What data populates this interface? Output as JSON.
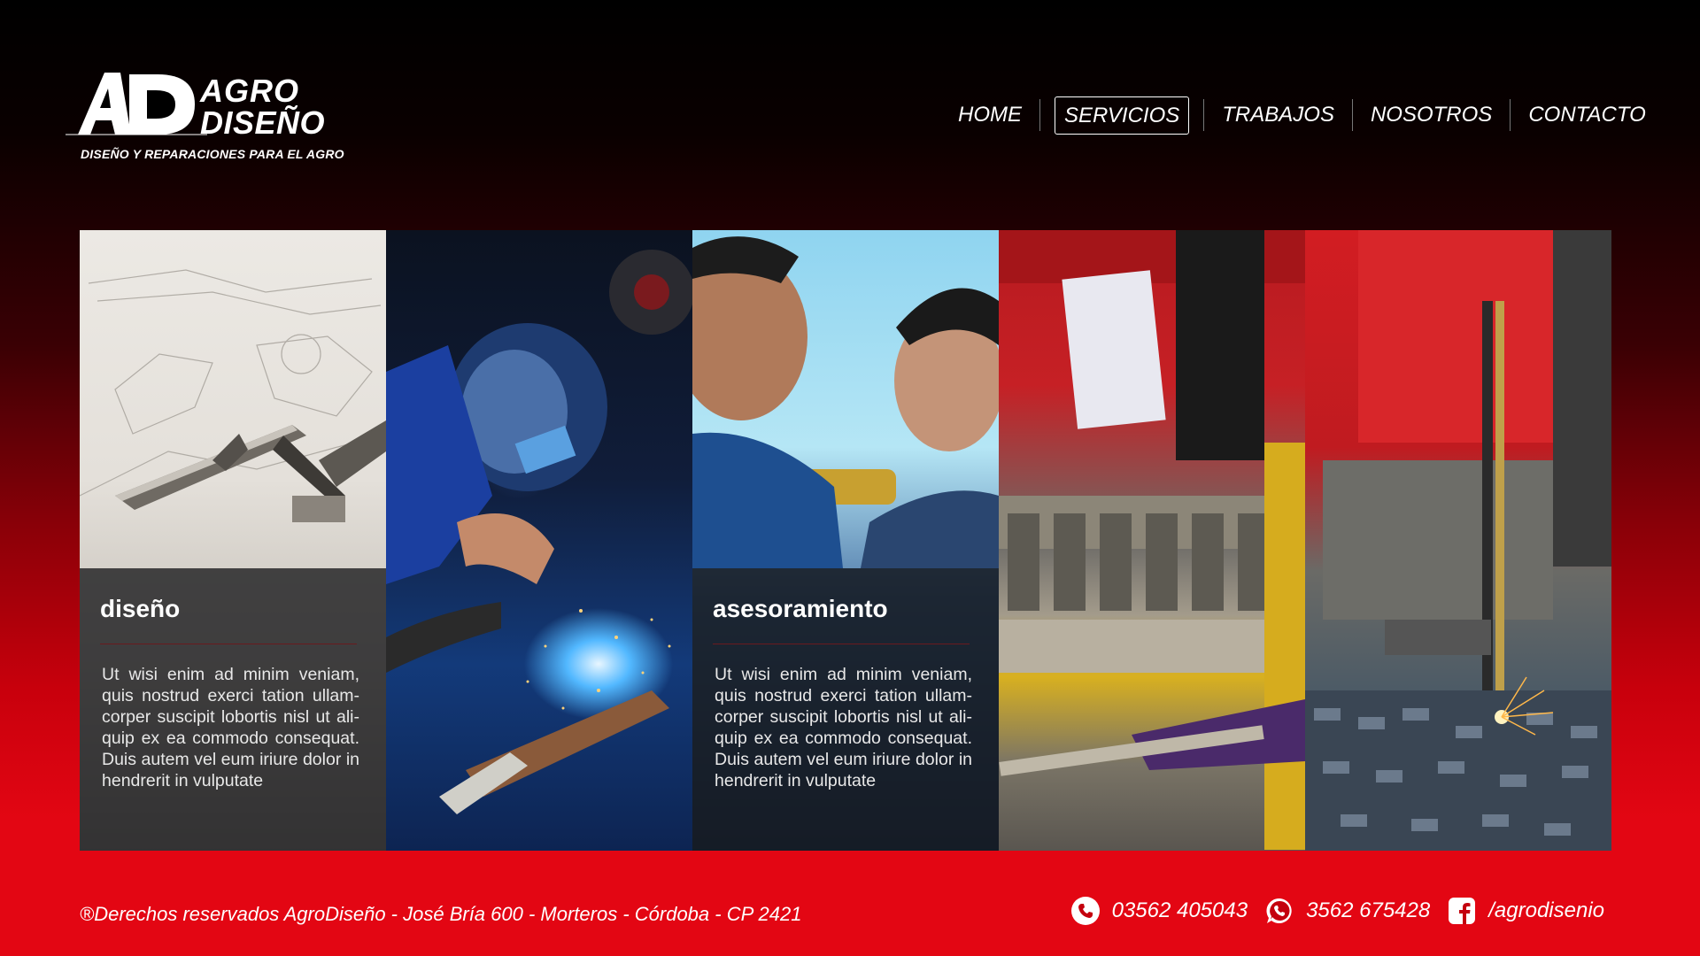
{
  "brand": {
    "word1": "AGRO",
    "word2": "DISEÑO",
    "tagline": "DISEÑO Y REPARACIONES PARA EL AGRO"
  },
  "nav": {
    "items": [
      {
        "label": "HOME"
      },
      {
        "label": "SERVICIOS"
      },
      {
        "label": "TRABAJOS"
      },
      {
        "label": "NOSOTROS"
      },
      {
        "label": "CONTACTO"
      }
    ],
    "active": "SERVICIOS"
  },
  "services": [
    {
      "title": "diseño",
      "text": "Ut wisi enim ad minim veniam, quis nostrud exerci tation ullam-corper suscipit lobortis nisl ut ali-quip ex ea commodo consequat. Duis autem vel eum iriure dolor in hendrerit in vulputate"
    },
    {
      "title": "asesoramiento",
      "text": "Ut wisi enim ad minim veniam, quis nostrud exerci tation ullam-corper suscipit lobortis nisl ut ali-quip ex ea commodo consequat. Duis autem vel eum iriure dolor in hendrerit in vulputate"
    }
  ],
  "footer": {
    "copyright": "®Derechos reservados AgroDiseño - José Bría 600  - Morteros - Córdoba - CP 2421",
    "phone": "03562 405043",
    "whatsapp": "3562 675428",
    "facebook": "/agrodisenio"
  },
  "colors": {
    "brand_red": "#e30613",
    "background_top": "#000000"
  },
  "icons": [
    "phone-icon",
    "whatsapp-icon",
    "facebook-icon"
  ]
}
